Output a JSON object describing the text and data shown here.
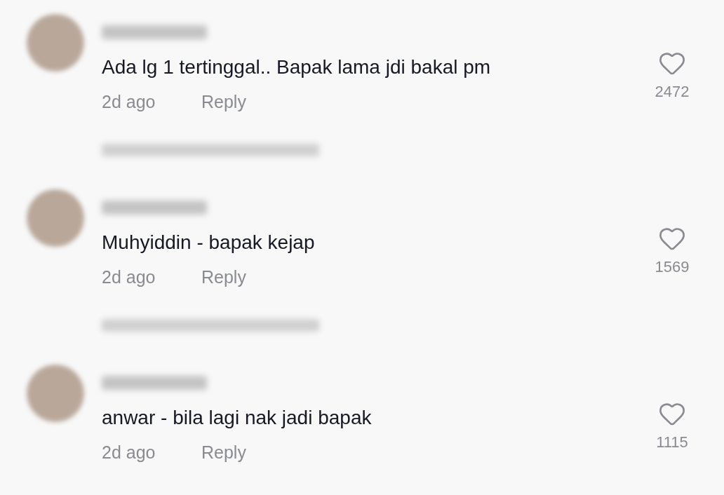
{
  "comments": [
    {
      "text": "Ada lg 1 tertinggal.. Bapak lama jdi bakal pm",
      "time": "2d ago",
      "reply": "Reply",
      "likes": "2472",
      "show_replies": true
    },
    {
      "text": "Muhyiddin - bapak kejap",
      "time": "2d ago",
      "reply": "Reply",
      "likes": "1569",
      "show_replies": true
    },
    {
      "text": "anwar - bila lagi nak jadi bapak",
      "time": "2d ago",
      "reply": "Reply",
      "likes": "1115",
      "show_replies": false
    }
  ]
}
